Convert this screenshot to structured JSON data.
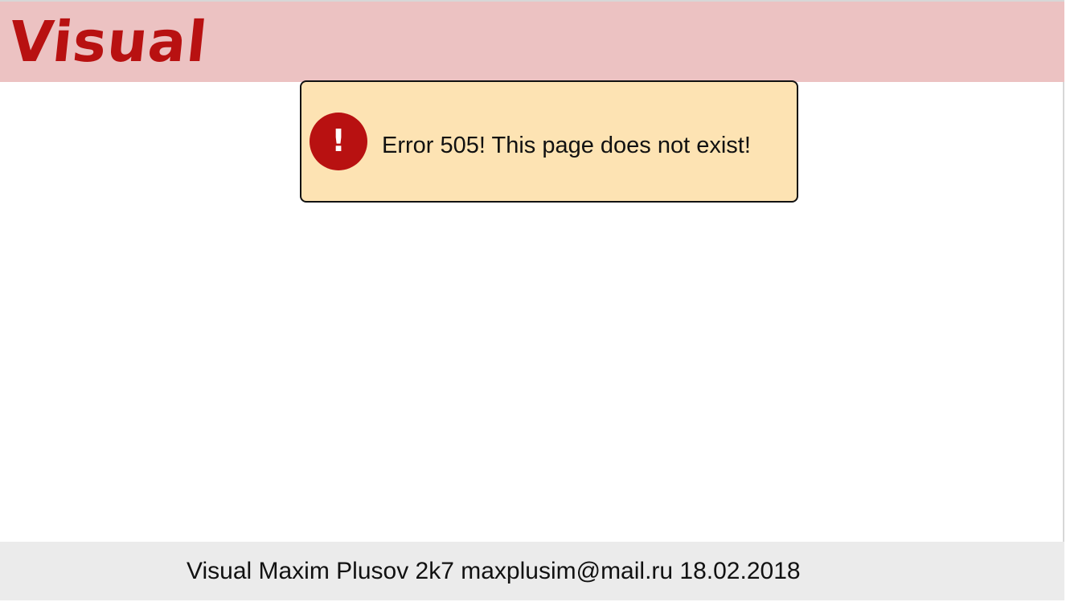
{
  "header": {
    "logo_text": "Visual",
    "background_color": "#ecc2c2",
    "logo_color": "#b81111"
  },
  "error": {
    "icon": "exclamation-circle-icon",
    "icon_glyph": "!",
    "message": "Error 505! This page does not exist!",
    "background_color": "#fde3b3",
    "icon_color": "#b81111"
  },
  "footer": {
    "text": "Visual Maxim Plusov 2k7 maxplusim@mail.ru 18.02.2018",
    "background_color": "#ebebeb"
  }
}
